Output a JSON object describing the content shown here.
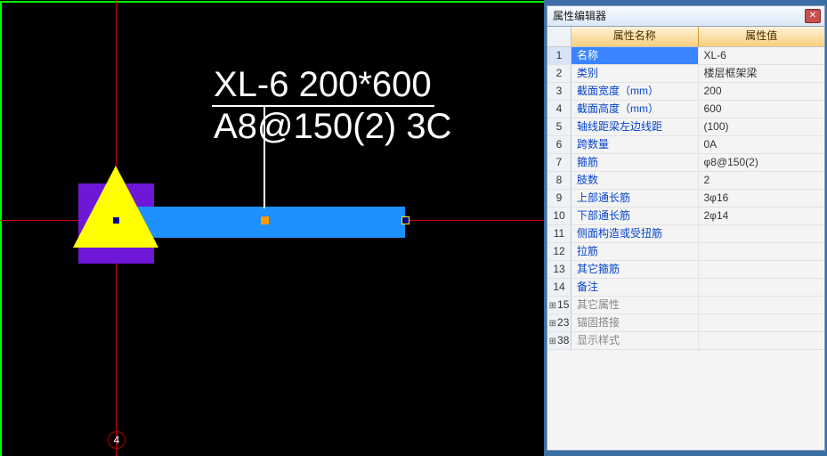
{
  "canvas": {
    "annotation_line1": "XL-6 200*600",
    "annotation_line2": "A8@150(2) 3C",
    "axis_label": "4"
  },
  "panel": {
    "title": "属性编辑器",
    "header_name": "属性名称",
    "header_value": "属性值",
    "rows": [
      {
        "num": "1",
        "name": "名称",
        "value": "XL-6",
        "selected": true
      },
      {
        "num": "2",
        "name": "类别",
        "value": "楼层框架梁"
      },
      {
        "num": "3",
        "name": "截面宽度（mm）",
        "value": "200"
      },
      {
        "num": "4",
        "name": "截面高度（mm）",
        "value": "600"
      },
      {
        "num": "5",
        "name": "轴线距梁左边线距",
        "value": "(100)"
      },
      {
        "num": "6",
        "name": "跨数量",
        "value": "0A"
      },
      {
        "num": "7",
        "name": "箍筋",
        "value": "φ8@150(2)"
      },
      {
        "num": "8",
        "name": "肢数",
        "value": "2"
      },
      {
        "num": "9",
        "name": "上部通长筋",
        "value": "3φ16"
      },
      {
        "num": "10",
        "name": "下部通长筋",
        "value": "2φ14"
      },
      {
        "num": "11",
        "name": "侧面构造或受扭筋",
        "value": ""
      },
      {
        "num": "12",
        "name": "拉筋",
        "value": ""
      },
      {
        "num": "13",
        "name": "其它箍筋",
        "value": ""
      },
      {
        "num": "14",
        "name": "备注",
        "value": ""
      },
      {
        "num": "15",
        "name": "其它属性",
        "value": "",
        "expandable": true,
        "gray": true
      },
      {
        "num": "23",
        "name": "锚固搭接",
        "value": "",
        "expandable": true,
        "gray": true
      },
      {
        "num": "38",
        "name": "显示样式",
        "value": "",
        "expandable": true,
        "gray": true
      }
    ]
  }
}
